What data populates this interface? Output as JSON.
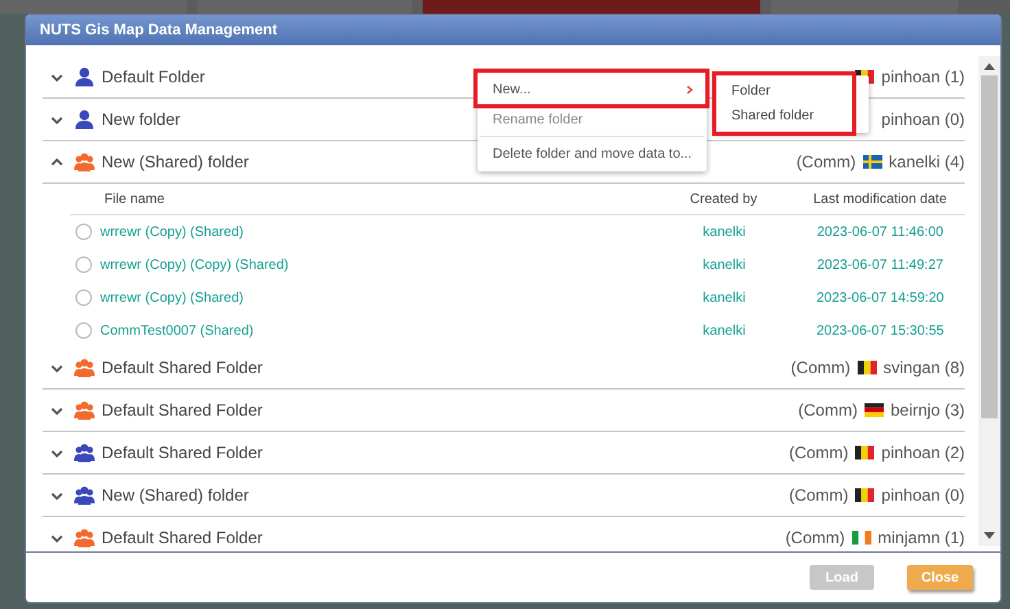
{
  "dialog": {
    "title": "NUTS Gis Map Data Management"
  },
  "folders": [
    {
      "name": "Default Folder",
      "kind": "person",
      "color": "#3a48b8",
      "expanded": false,
      "owner": "pinhoan (1)",
      "flag": {
        "kind": "belgian"
      }
    },
    {
      "name": "New folder",
      "kind": "person",
      "color": "#3a48b8",
      "expanded": false,
      "owner": "pinhoan (0)"
    },
    {
      "name": "New (Shared) folder",
      "kind": "group",
      "color": "#f26a2e",
      "expanded": true,
      "comm": "(Comm)",
      "flag": {
        "kind": "swedish"
      },
      "owner": "kanelki (4)",
      "columns": [
        "File name",
        "Created by",
        "Last modification date"
      ],
      "files": [
        {
          "name": "wrrewr (Copy) (Shared)",
          "created_by": "kanelki",
          "modified": "2023-06-07 11:46:00",
          "selected": false
        },
        {
          "name": "wrrewr (Copy) (Copy) (Shared)",
          "created_by": "kanelki",
          "modified": "2023-06-07 11:49:27",
          "selected": false
        },
        {
          "name": "wrrewr (Copy) (Shared)",
          "created_by": "kanelki",
          "modified": "2023-06-07 14:59:20",
          "selected": false
        },
        {
          "name": "CommTest0007 (Shared)",
          "created_by": "kanelki",
          "modified": "2023-06-07 15:30:55",
          "selected": false
        }
      ]
    },
    {
      "name": "Default Shared Folder",
      "kind": "group",
      "color": "#f26a2e",
      "expanded": false,
      "comm": "(Comm)",
      "flag": {
        "kind": "belgian"
      },
      "owner": "svingan (8)"
    },
    {
      "name": "Default Shared Folder",
      "kind": "group",
      "color": "#f26a2e",
      "expanded": false,
      "comm": "(Comm)",
      "flag": {
        "kind": "german"
      },
      "owner": "beirnjo (3)"
    },
    {
      "name": "Default Shared Folder",
      "kind": "group",
      "color": "#3a48b8",
      "expanded": false,
      "comm": "(Comm)",
      "flag": {
        "kind": "belgian"
      },
      "owner": "pinhoan (2)"
    },
    {
      "name": "New (Shared) folder",
      "kind": "group",
      "color": "#3a48b8",
      "expanded": false,
      "comm": "(Comm)",
      "flag": {
        "kind": "belgian"
      },
      "owner": "pinhoan (0)"
    },
    {
      "name": "Default Shared Folder",
      "kind": "group",
      "color": "#f26a2e",
      "expanded": false,
      "comm": "(Comm)",
      "flag": {
        "kind": "irish"
      },
      "owner": "minjamn (1)"
    }
  ],
  "context_menu": {
    "items": [
      {
        "label": "New...",
        "submenu": true,
        "disabled": false,
        "annotated": true
      },
      {
        "label": "Rename folder",
        "submenu": false,
        "disabled": true,
        "annotated": false
      },
      {
        "label": "Delete folder and move data to...",
        "submenu": true,
        "disabled": false,
        "annotated": false
      }
    ],
    "submenu": {
      "items": [
        "Folder",
        "Shared folder"
      ],
      "annotated": true
    }
  },
  "buttons": [
    {
      "label": "Load",
      "disabled": true
    },
    {
      "label": "Close",
      "disabled": false
    }
  ]
}
